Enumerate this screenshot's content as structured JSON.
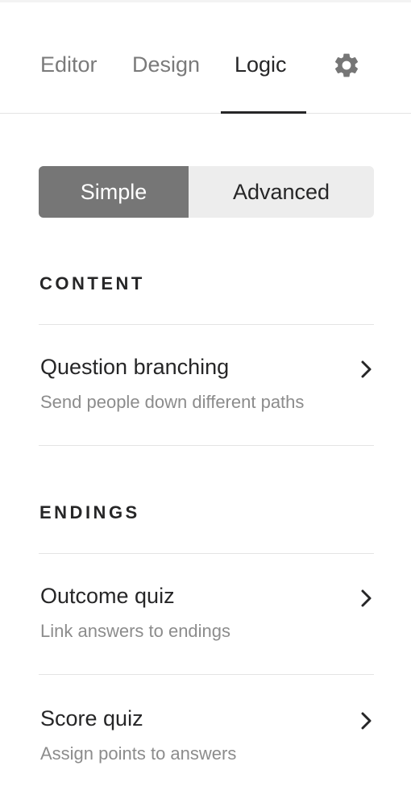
{
  "tabs": [
    {
      "label": "Editor"
    },
    {
      "label": "Design"
    },
    {
      "label": "Logic",
      "active": true
    }
  ],
  "settings_icon": "gear-icon",
  "mode_toggle": {
    "options": [
      "Simple",
      "Advanced"
    ],
    "selected": "Simple"
  },
  "sections": {
    "content": {
      "heading": "CONTENT",
      "items": [
        {
          "title": "Question branching",
          "description": "Send people down different paths",
          "icon": "chevron-right-icon"
        }
      ]
    },
    "endings": {
      "heading": "ENDINGS",
      "items": [
        {
          "title": "Outcome quiz",
          "description": "Link answers to endings",
          "icon": "chevron-right-icon"
        },
        {
          "title": "Score quiz",
          "description": "Assign points to answers",
          "icon": "chevron-right-icon"
        }
      ]
    }
  },
  "colors": {
    "text_primary": "#262627",
    "text_muted": "#7a7a7a",
    "text_description": "#8c8c8c",
    "segment_selected_bg": "#767676",
    "segment_bg": "#ededed",
    "divider": "#e4e4e4"
  }
}
